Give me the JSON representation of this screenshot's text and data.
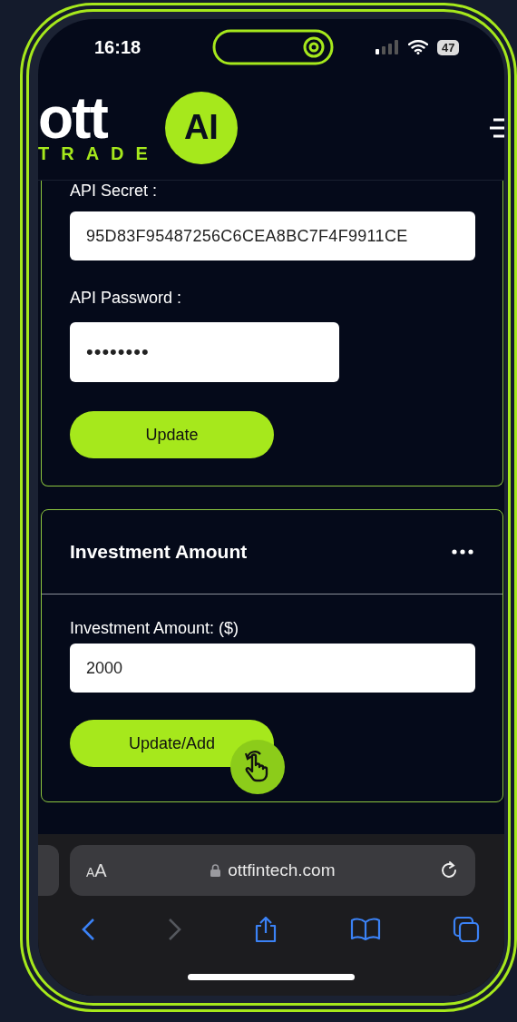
{
  "status_bar": {
    "time": "16:18",
    "battery": "47"
  },
  "logo": {
    "wordmark": "ott",
    "tagline": "TRADE",
    "badge": "AI"
  },
  "api_card": {
    "fields": [
      {
        "label": "API Secret :",
        "value": "95D83F95487256C6CEA8BC7F4F9911CE",
        "kind": "text"
      },
      {
        "label": "API Password :",
        "value": "••••••••",
        "kind": "password"
      }
    ],
    "button": "Update"
  },
  "investment_card": {
    "title": "Investment Amount",
    "field": {
      "label": "Investment Amount: ($)",
      "value": "2000"
    },
    "button": "Update/Add"
  },
  "browser": {
    "text_size_button": "AA",
    "url": "ottfintech.com",
    "back": {
      "disabled": false
    },
    "forward": {
      "disabled": true
    }
  }
}
